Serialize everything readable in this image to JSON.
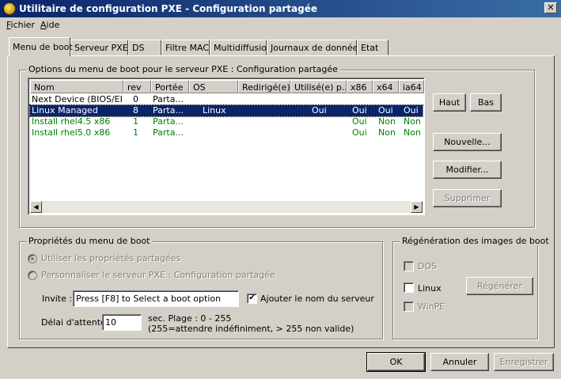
{
  "window": {
    "title": "Utilitaire de configuration PXE - Configuration partagée",
    "close_label": "✕",
    "app_icon": "pxe-gear-icon"
  },
  "menu": [
    {
      "label": "Fichier"
    },
    {
      "label": "Aide"
    }
  ],
  "tabs": [
    {
      "label": "Menu de boot",
      "active": true
    },
    {
      "label": "Serveur PXE"
    },
    {
      "label": "DS"
    },
    {
      "label": "Filtre MAC"
    },
    {
      "label": "Multidiffusion"
    },
    {
      "label": "Journaux de données"
    },
    {
      "label": "Etat"
    }
  ],
  "boot_menu": {
    "group_label": "Options du menu de boot pour le serveur PXE :  Configuration partagée",
    "columns": [
      "Nom",
      "rev",
      "Portée",
      "OS",
      "Redirigé(e)",
      "Utilisé(e) p...",
      "x86",
      "x64",
      "ia64"
    ],
    "rows": [
      {
        "nom": "Next Device (BIOS/EFI)",
        "rev": "0",
        "portee": "Parta...",
        "os": "",
        "redirige": "",
        "utilise": "",
        "x86": "",
        "x64": "",
        "ia64": ""
      },
      {
        "nom": "Linux Managed",
        "rev": "8",
        "portee": "Parta...",
        "os": "Linux",
        "redirige": "",
        "utilise": "Oui",
        "x86": "Oui",
        "x64": "Oui",
        "ia64": "Oui"
      },
      {
        "nom": "Install rhel4.5 x86",
        "rev": "1",
        "portee": "Parta...",
        "os": "",
        "redirige": "",
        "utilise": "",
        "x86": "Oui",
        "x64": "Non",
        "ia64": "Non"
      },
      {
        "nom": "Install rhel5.0 x86",
        "rev": "1",
        "portee": "Parta...",
        "os": "",
        "redirige": "",
        "utilise": "",
        "x86": "Oui",
        "x64": "Non",
        "ia64": "Non"
      }
    ],
    "selected_row": 1,
    "buttons": {
      "haut": "Haut",
      "bas": "Bas",
      "nouvelle": "Nouvelle...",
      "modifier": "Modifier...",
      "supprimer": "Supprimer"
    },
    "scroll_left_label": "◀",
    "scroll_right_label": "▶"
  },
  "properties": {
    "group_label": "Propriétés du menu de boot",
    "radio_shared": "Utiliser les propriétés partagées",
    "radio_custom": "Personnaliser le serveur PXE :  Configuration partagée",
    "invite_label": "Invite :",
    "invite_value": "Press [F8] to Select a boot option",
    "add_server_name_label": "Ajouter le nom du serveur",
    "add_server_name_checked": true,
    "checkmark": "✔",
    "delay_label": "Délai d'attente :",
    "delay_value": "10",
    "delay_hint_1": "sec. Plage : 0 - 255",
    "delay_hint_2": "(255=attendre indéfiniment, > 255 non valide)"
  },
  "regeneration": {
    "group_label": "Régénération des images de boot",
    "options": [
      "DOS",
      "Linux",
      "WinPE"
    ],
    "regenerate_button": "Régénérer"
  },
  "footer": {
    "ok": "OK",
    "annuler": "Annuler",
    "enregistrer": "Enregistrer"
  }
}
